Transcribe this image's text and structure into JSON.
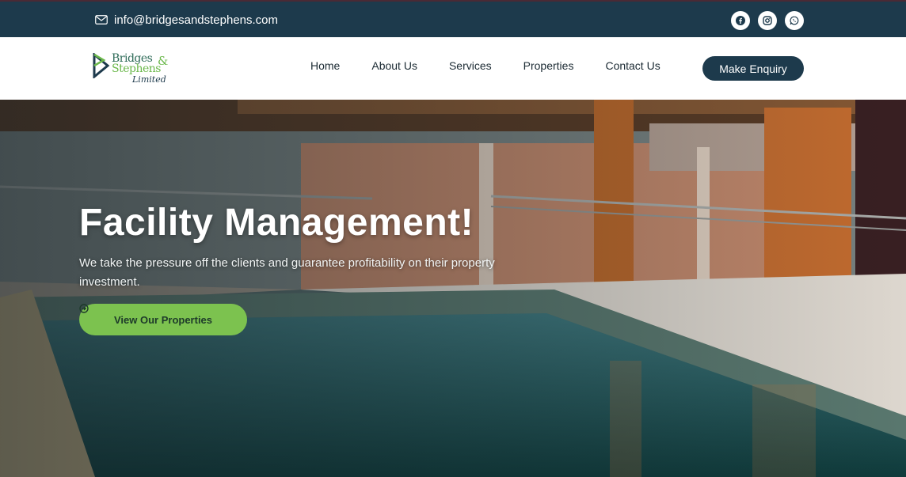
{
  "topbar": {
    "email": "info@bridgesandstephens.com",
    "email_icon": "envelope-icon",
    "socials": [
      "facebook-icon",
      "instagram-icon",
      "whatsapp-icon"
    ]
  },
  "brand": {
    "name_line1": "Bridges",
    "ampersand": "&",
    "name_line2": "Stephens",
    "name_line3": "Limited"
  },
  "nav": {
    "items": [
      {
        "label": "Home"
      },
      {
        "label": "About Us"
      },
      {
        "label": "Services"
      },
      {
        "label": "Properties"
      },
      {
        "label": "Contact Us"
      }
    ],
    "cta_label": "Make Enquiry"
  },
  "hero": {
    "title": "Facility Management!",
    "text": "We take the pressure off the clients and guarantee profitability on their property investment.",
    "button_label": "View Our Properties",
    "button_icon": "arrow-circle-right-icon"
  },
  "colors": {
    "navy": "#1d3a4c",
    "green": "#7cc24f"
  }
}
